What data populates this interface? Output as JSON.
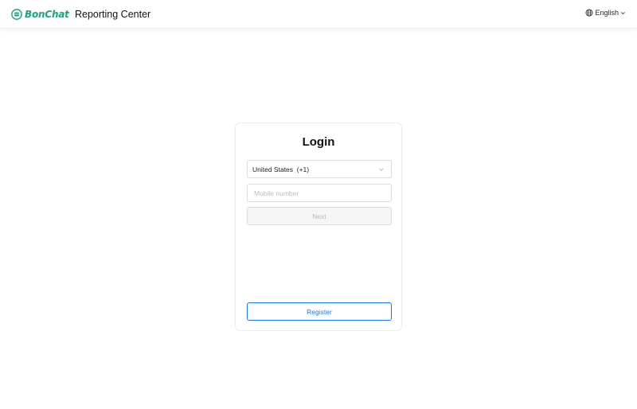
{
  "header": {
    "logo_text": "BonChat",
    "title": "Reporting Center",
    "language": "English"
  },
  "login": {
    "title": "Login",
    "country_value": "United States  (+1)",
    "mobile_placeholder": "Mobile number",
    "next_label": "Next",
    "register_label": "Register"
  },
  "colors": {
    "brand": "#12a87a",
    "primary": "#1677ff",
    "disabled_bg": "#f5f5f5",
    "disabled_text": "#bdbdbd"
  },
  "icons": {
    "logo": "bonchat-logo-icon",
    "language": "globe-icon",
    "language_dropdown": "chevron-down-icon",
    "country_dropdown": "chevron-down-icon"
  }
}
